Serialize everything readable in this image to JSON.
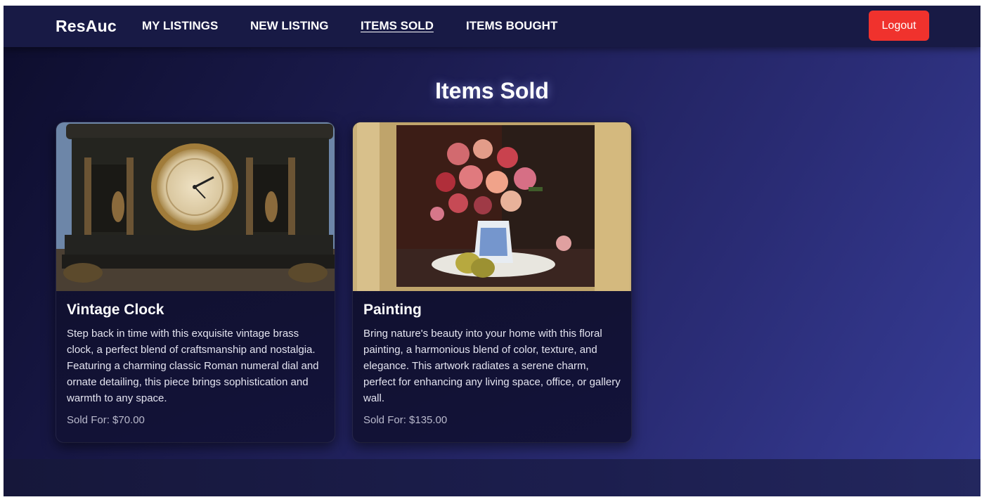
{
  "nav": {
    "brand": "ResAuc",
    "links": [
      {
        "label": "MY LISTINGS"
      },
      {
        "label": "NEW LISTING"
      },
      {
        "label": "ITEMS SOLD"
      },
      {
        "label": "ITEMS BOUGHT"
      }
    ],
    "active": "ITEMS SOLD",
    "logout_label": "Logout"
  },
  "page": {
    "title": "Items Sold"
  },
  "items": [
    {
      "title": "Vintage Clock",
      "description": "Step back in time with this exquisite vintage brass clock, a perfect blend of craftsmanship and nostalgia. Featuring a charming classic Roman numeral dial and ornate detailing, this piece brings sophistication and warmth to any space.",
      "price": "Sold For: $70.00",
      "image": "vintage-clock-photo"
    },
    {
      "title": "Painting",
      "description": "Bring nature's beauty into your home with this floral painting, a harmonious blend of color, texture, and elegance. This artwork radiates a serene charm, perfect for enhancing any living space, office, or gallery wall.",
      "price": "Sold For: $135.00",
      "image": "floral-painting-photo"
    }
  ],
  "colors": {
    "navbar": "#181a45",
    "logout": "#f0322d",
    "background_start": "#0d0d2c",
    "background_end": "#373d98",
    "card": "#0f0f29"
  }
}
